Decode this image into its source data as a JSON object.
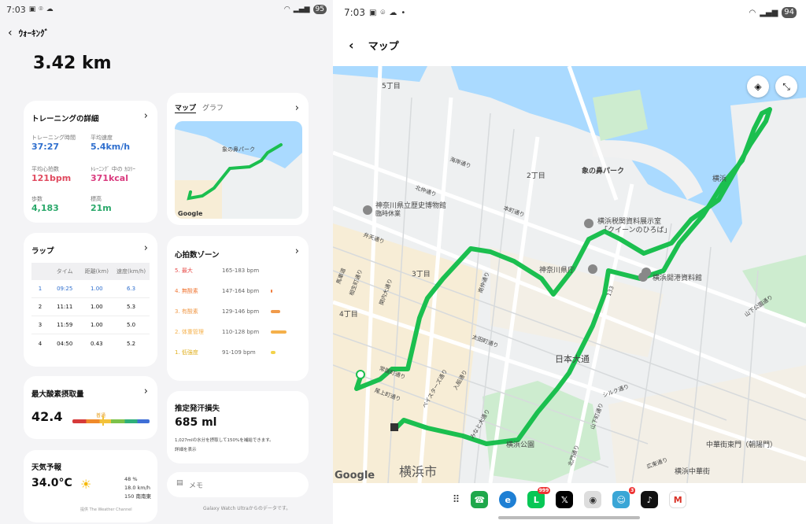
{
  "left_status": {
    "time": "7:03",
    "battery": "95"
  },
  "right_status": {
    "time": "7:03",
    "battery": "94"
  },
  "header": {
    "title": "ｳｫｰｷﾝｸﾞ"
  },
  "distance": "3.42 km",
  "training": {
    "title": "トレーニングの詳細",
    "items": [
      {
        "label": "トレーニング時間",
        "value": "37:27"
      },
      {
        "label": "平均速度",
        "value": "5.4km/h"
      },
      {
        "label": "平均心拍数",
        "value": "121bpm"
      },
      {
        "label": "ﾄﾚｰﾆﾝｸﾞ 中の ｶﾛﾘｰ",
        "value": "371kcal"
      },
      {
        "label": "歩数",
        "value": "4,183"
      },
      {
        "label": "標高",
        "value": "21m"
      }
    ]
  },
  "laps": {
    "title": "ラップ",
    "headers": [
      "",
      "タイム",
      "距離(km)",
      "速度(km/h)"
    ],
    "rows": [
      [
        "1",
        "09:25",
        "1.00",
        "6.3"
      ],
      [
        "2",
        "11:11",
        "1.00",
        "5.3"
      ],
      [
        "3",
        "11:59",
        "1.00",
        "5.0"
      ],
      [
        "4",
        "04:50",
        "0.43",
        "5.2"
      ]
    ]
  },
  "vo2": {
    "title": "最大酸素摂取量",
    "value": "42.4",
    "level": "普通"
  },
  "weather": {
    "title": "天気予報",
    "temp": "34.0°C",
    "humidity": "48 %",
    "wind": "18.0 km/h",
    "direction": "150 南南東",
    "source": "提供  The Weather Channel"
  },
  "mapcard": {
    "tab_map": "マップ",
    "tab_graph": "グラフ"
  },
  "hrzones": {
    "title": "心拍数ゾーン",
    "zones": [
      {
        "name": "5. 最大",
        "range": "165-183 bpm",
        "color": "#e8504d",
        "fill": 0.0
      },
      {
        "name": "4. 無酸素",
        "range": "147-164 bpm",
        "color": "#f07a3a",
        "fill": 0.02
      },
      {
        "name": "3. 有酸素",
        "range": "129-146 bpm",
        "color": "#f09a4a",
        "fill": 0.15
      },
      {
        "name": "2. 体重管理",
        "range": "110-128 bpm",
        "color": "#f5b04a",
        "fill": 0.25
      },
      {
        "name": "1. 低強度",
        "range": "91-109 bpm",
        "color": "#f3d24a",
        "fill": 0.08
      }
    ]
  },
  "sweat": {
    "title": "推定発汗損失",
    "value": "685 ml",
    "desc": "1,027mlの水分を摂取して150%を補給できます。",
    "link": "詳細を表示"
  },
  "memo": {
    "label": "メモ"
  },
  "footer": "Galaxy Watch Ultraからのデータです。",
  "map": {
    "title": "マップ",
    "labels": {
      "chome5": "5丁目",
      "chome2": "2丁目",
      "chome3": "3丁目",
      "chome4": "4丁目",
      "zounohana": "象の鼻パーク",
      "museum": "神奈川県立歴史博物館",
      "museum_sub": "臨時休業",
      "customs": "横浜税関資料展示室",
      "customs_sub": "「クイーンのひろば」",
      "pref": "神奈川県庁",
      "port": "横浜開港資料館",
      "nihon": "日本大通",
      "yokohama_park": "横浜公園",
      "yokohama_city": "横浜市",
      "chinatown_gate": "中華街東門（朝陽門）",
      "chinatown": "横浜中華街",
      "yamashita": "山下公園通り",
      "yokohama": "横浜",
      "honmachi": "本町通り",
      "kaigan": "海岸通り",
      "benten": "弁天通り",
      "kita": "北仲通り",
      "minami": "南仲通り",
      "ota": "太田町通り",
      "tokiwa": "常盤町通り",
      "onoe": "尾上町通り",
      "bayster": "ベイスターズ通り",
      "irifune": "入船通り",
      "minato": "みなと大通り",
      "sakuraba": "相生町通り",
      "bashamichi": "馬車道",
      "kannai": "関内大通り",
      "silk": "シルク通り",
      "yamashitacho": "山下町通り",
      "kitanaka": "北門通り",
      "hironabe": "広東通り",
      "hwy": "133"
    }
  },
  "dock": [
    "phone",
    "edge",
    "line",
    "x",
    "camera",
    "app",
    "tiktok",
    "gmail"
  ],
  "dock_badges": {
    "line": "999",
    "app": "3"
  },
  "colors": {
    "route": "#1bbf4f",
    "water": "#aadaff",
    "park": "#cdeccf",
    "block": "#f7edd6"
  }
}
